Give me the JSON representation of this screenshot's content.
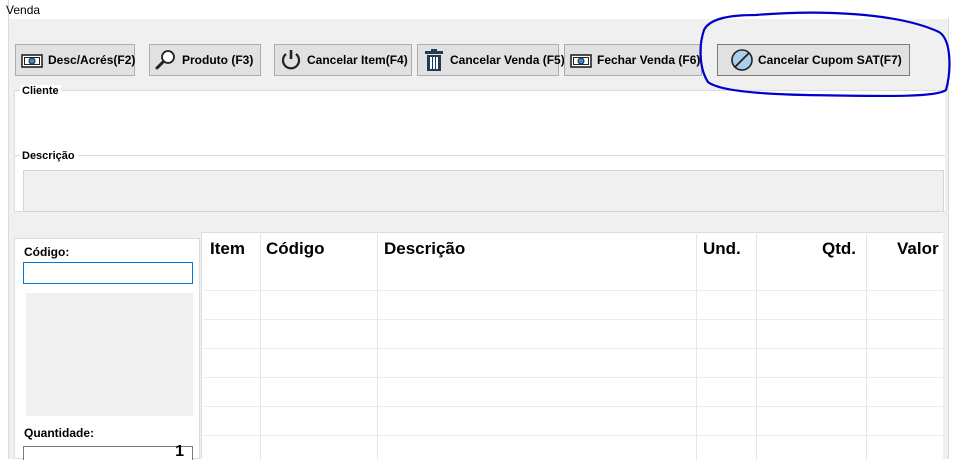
{
  "window": {
    "title": "Venda"
  },
  "toolbar": {
    "buttons": [
      {
        "label": "Desc/Acrés(F2)",
        "icon": "money-icon"
      },
      {
        "label": "Produto (F3)",
        "icon": "magnifier-icon"
      },
      {
        "label": "Cancelar Item(F4)",
        "icon": "power-icon"
      },
      {
        "label": "Cancelar Venda (F5)",
        "icon": "trash-icon"
      },
      {
        "label": "Fechar Venda (F6)",
        "icon": "money-icon"
      },
      {
        "label": "Cancelar Cupom SAT(F7)",
        "icon": "cancel-circle-icon"
      }
    ]
  },
  "cliente": {
    "label": "Cliente",
    "value": ""
  },
  "descricao": {
    "label": "Descrição",
    "value": ""
  },
  "left": {
    "codigo_label": "Código:",
    "codigo_value": "",
    "quantidade_label": "Quantidade:",
    "quantidade_value": "1"
  },
  "grid": {
    "columns": [
      "Item",
      "Código",
      "Descrição",
      "Und.",
      "Qtd.",
      "Valor"
    ],
    "rows": []
  },
  "colors": {
    "accent": "#0078d7",
    "annotation": "#0000cc"
  }
}
